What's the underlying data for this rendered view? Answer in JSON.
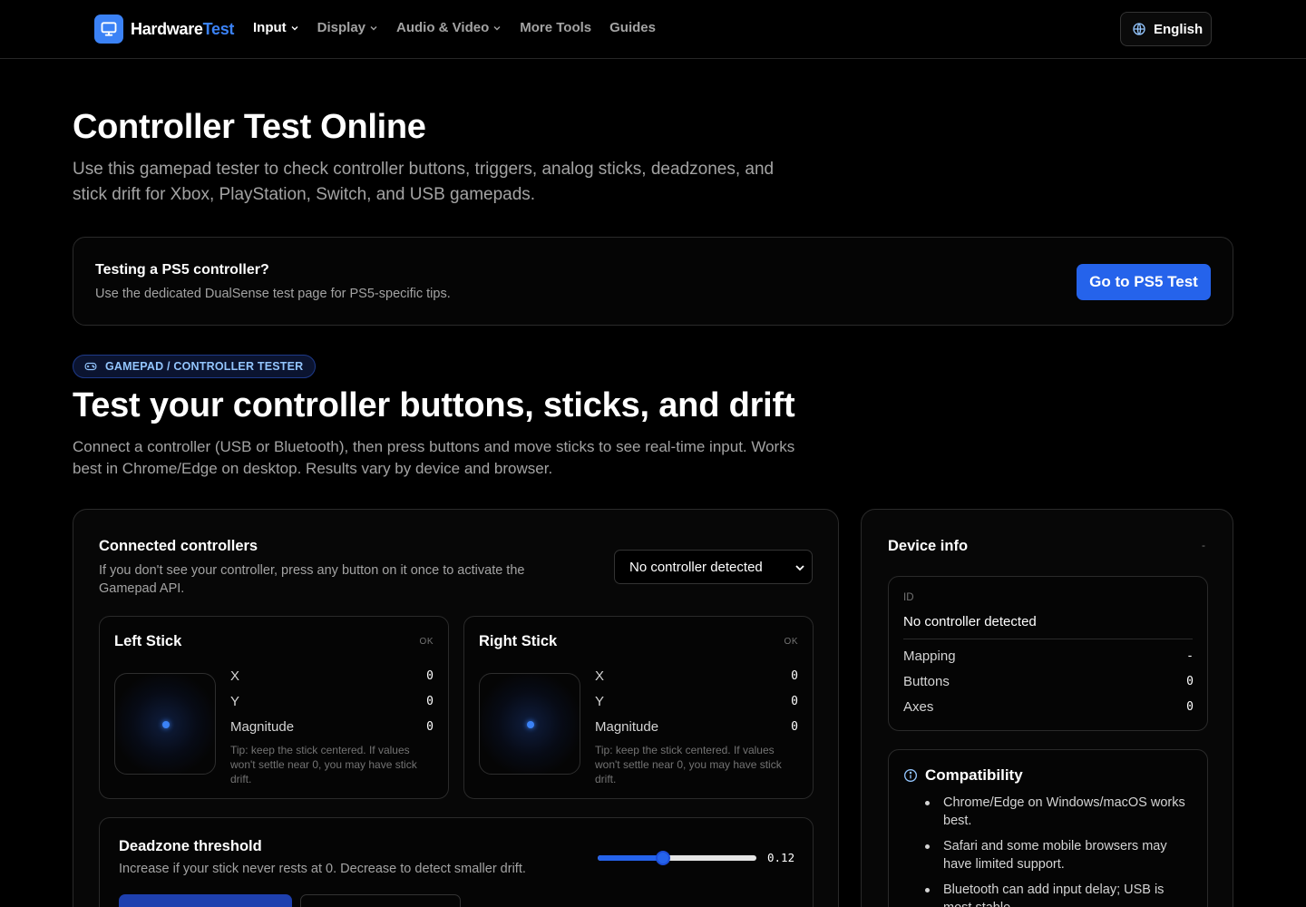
{
  "header": {
    "logo_primary": "Hardware",
    "logo_accent": "Test",
    "nav": [
      {
        "label": "Input"
      },
      {
        "label": "Display"
      },
      {
        "label": "Audio & Video"
      },
      {
        "label": "More Tools"
      },
      {
        "label": "Guides"
      }
    ],
    "language": "English"
  },
  "hero": {
    "title": "Controller Test Online",
    "lead": "Use this gamepad tester to check controller buttons, triggers, analog sticks, deadzones, and stick drift for Xbox, PlayStation, Switch, and USB gamepads."
  },
  "ps5": {
    "title": "Testing a PS5 controller?",
    "subtitle": "Use the dedicated DualSense test page for PS5-specific tips.",
    "button": "Go to PS5 Test"
  },
  "tester": {
    "badge": "GAMEPAD / CONTROLLER TESTER",
    "title": "Test your controller buttons, sticks, and drift",
    "lead": "Connect a controller (USB or Bluetooth), then press buttons and move sticks to see real-time input. Works best in Chrome/Edge on desktop. Results vary by device and browser."
  },
  "connected": {
    "title": "Connected controllers",
    "subtitle": "If you don't see your controller, press any button on it once to activate the Gamepad API.",
    "select_value": "No controller detected"
  },
  "sticks": [
    {
      "title": "Left Stick",
      "status": "OK",
      "x_label": "X",
      "x": "0",
      "y_label": "Y",
      "y": "0",
      "mag_label": "Magnitude",
      "mag": "0",
      "tip": "Tip: keep the stick centered. If values won't settle near 0, you may have stick drift."
    },
    {
      "title": "Right Stick",
      "status": "OK",
      "x_label": "X",
      "x": "0",
      "y_label": "Y",
      "y": "0",
      "mag_label": "Magnitude",
      "mag": "0",
      "tip": "Tip: keep the stick centered. If values won't settle near 0, you may have stick drift."
    }
  ],
  "deadzone": {
    "title": "Deadzone threshold",
    "subtitle": "Increase if your stick never rests at 0. Decrease to detect smaller drift.",
    "value": "0.12",
    "slider_fraction": 0.41
  },
  "device": {
    "title": "Device info",
    "status": "-",
    "id_label": "ID",
    "id_value": "No controller detected",
    "rows": [
      {
        "label": "Mapping",
        "value": "-"
      },
      {
        "label": "Buttons",
        "value": "0"
      },
      {
        "label": "Axes",
        "value": "0"
      }
    ]
  },
  "compat": {
    "title": "Compatibility",
    "items": [
      "Chrome/Edge on Windows/macOS works best.",
      "Safari and some mobile browsers may have limited support.",
      "Bluetooth can add input delay; USB is most stable."
    ]
  },
  "colors": {
    "accent": "#3b82f6",
    "button": "#2563eb",
    "background": "#000000"
  }
}
